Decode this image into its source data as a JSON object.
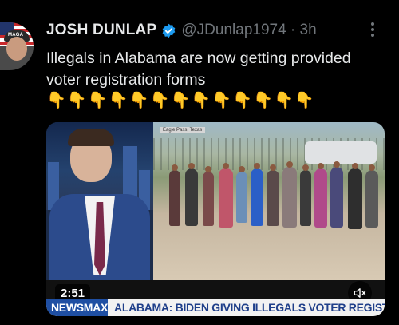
{
  "tweet": {
    "display_name": "JOSH DUNLAP",
    "handle_time": "@JDunlap1974 · 3h",
    "text": "Illegals in Alabama are now getting provided voter registration forms",
    "emojis": [
      "👇",
      "👇",
      "👇",
      "👇",
      "👇",
      "👇",
      "👇",
      "👇",
      "👇",
      "👇",
      "👇",
      "👇",
      "👇"
    ],
    "avatar_cap_text": "MAGA"
  },
  "media": {
    "scene_caption": "Eagle Pass, Texas",
    "duration": "2:51",
    "ticker_brand": "NEWSMAX",
    "ticker_text": "ALABAMA: BIDEN GIVING ILLEGALS VOTER REGISTRATION"
  },
  "colors": {
    "background": "#000000",
    "primary_text": "#e7e9ea",
    "secondary_text": "#71767b",
    "verified_blue": "#1d9bf0",
    "newsmax_blue": "#1f4fa3"
  },
  "icons": {
    "verified": "verified-badge-icon",
    "more": "more-options-icon",
    "mute": "speaker-muted-icon"
  }
}
